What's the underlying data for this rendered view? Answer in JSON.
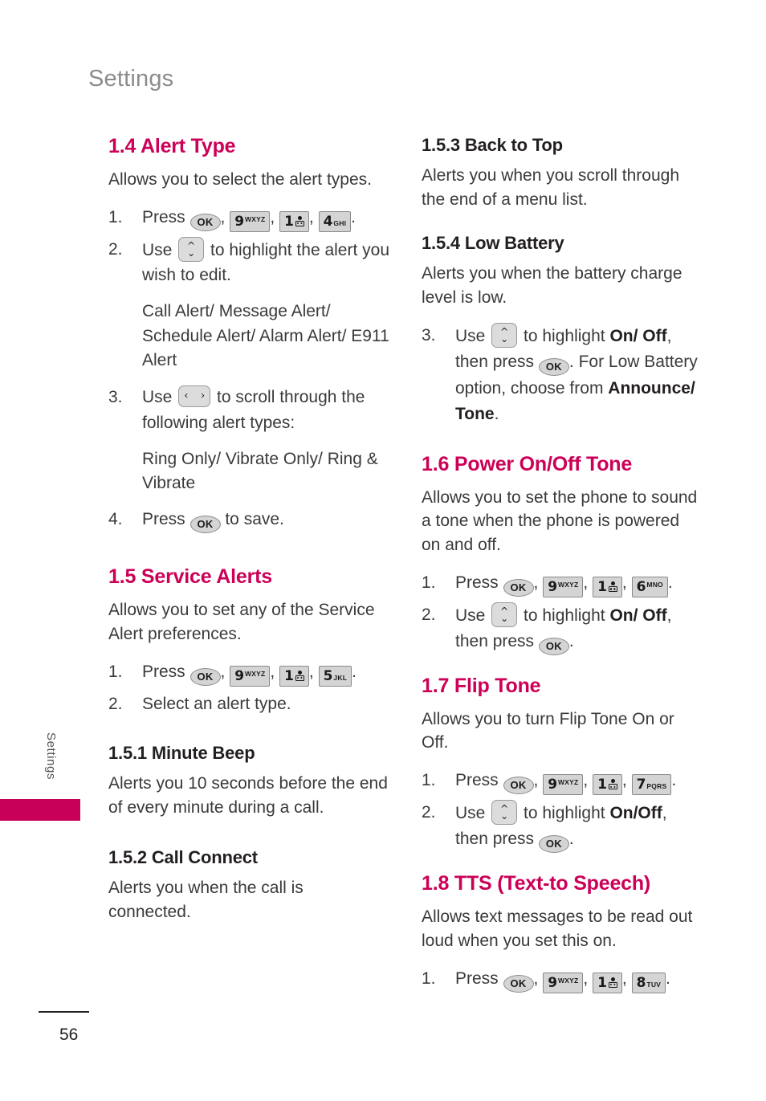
{
  "page": {
    "header_title": "Settings",
    "side_tab_label": "Settings",
    "page_number": "56",
    "accent_color": "#cc0057",
    "tab_color": "#c8005a",
    "header_color": "#8c8c8c"
  },
  "keys": {
    "ok": "OK",
    "nine": {
      "digit": "9",
      "letters": "WXYZ"
    },
    "one": {
      "digit": "1",
      "icon": "voicemail-icon"
    },
    "four": {
      "digit": "4",
      "letters": "GHI"
    },
    "five": {
      "digit": "5",
      "letters": "JKL"
    },
    "six": {
      "digit": "6",
      "letters": "MNO"
    },
    "seven": {
      "digit": "7",
      "letters": "PQRS"
    },
    "eight": {
      "digit": "8",
      "letters": "TUV"
    },
    "updown": "up-down-rocker-icon",
    "leftright": "left-right-rocker-icon"
  },
  "left_column": {
    "s14": {
      "title": "1.4 Alert Type",
      "intro": "Allows you to select the alert types.",
      "step1_num": "1.",
      "step1_prefix": "Press ",
      "step1_suffix": ".",
      "step2_num": "2.",
      "step2_prefix": "Use ",
      "step2_suffix": " to highlight the alert you wish to edit.",
      "alert_list": "Call Alert/ Message Alert/ Schedule Alert/ Alarm Alert/ E911 Alert",
      "step3_num": "3.",
      "step3_prefix": "Use ",
      "step3_suffix": " to scroll through the following alert types:",
      "type_list": "Ring Only/ Vibrate Only/ Ring & Vibrate",
      "step4_num": "4.",
      "step4_prefix": "Press ",
      "step4_suffix": " to save."
    },
    "s15": {
      "title": "1.5 Service Alerts",
      "intro": "Allows you to set any of the Service Alert preferences.",
      "step1_num": "1.",
      "step1_prefix": "Press ",
      "step1_suffix": ".",
      "step2_num": "2.",
      "step2_text": "Select an alert type."
    },
    "s151": {
      "title": "1.5.1 Minute Beep",
      "body": "Alerts you 10 seconds before the end of every minute during a call."
    },
    "s152": {
      "title": "1.5.2 Call Connect",
      "body": "Alerts you when the call is connected."
    }
  },
  "right_column": {
    "s153": {
      "title": "1.5.3 Back to Top",
      "body": "Alerts you when you scroll through the end of a menu list."
    },
    "s154": {
      "title": "1.5.4 Low Battery",
      "body": "Alerts you when the battery charge level is low.",
      "step3_num": "3.",
      "step3_a": "Use ",
      "step3_b": " to highlight ",
      "step3_bold1": "On/ Off",
      "step3_c": ", then press ",
      "step3_d": ". For Low Battery option, choose from ",
      "step3_bold2": "Announce/ Tone",
      "step3_e": "."
    },
    "s16": {
      "title": "1.6 Power On/Off Tone",
      "intro": "Allows you to set the phone to sound a tone when the phone is powered on and off.",
      "step1_num": "1.",
      "step1_prefix": "Press ",
      "step1_suffix": ".",
      "step2_num": "2.",
      "step2_a": "Use ",
      "step2_b": " to highlight ",
      "step2_bold": "On/ Off",
      "step2_c": ", then press ",
      "step2_d": "."
    },
    "s17": {
      "title": "1.7 Flip Tone",
      "intro": "Allows you to turn Flip Tone On or Off.",
      "step1_num": "1.",
      "step1_prefix": "Press ",
      "step1_suffix": ".",
      "step2_num": "2.",
      "step2_a": "Use ",
      "step2_b": " to highlight ",
      "step2_bold": "On/Off",
      "step2_c": ", then press ",
      "step2_d": "."
    },
    "s18": {
      "title": "1.8 TTS (Text-to Speech)",
      "intro": "Allows text messages to be read out loud when you set this on.",
      "step1_num": "1.",
      "step1_prefix": "Press ",
      "step1_suffix": "."
    }
  }
}
